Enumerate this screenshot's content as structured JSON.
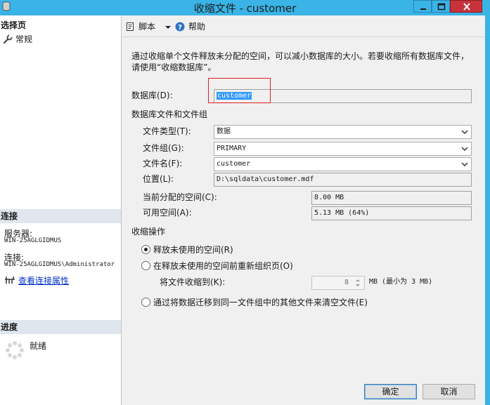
{
  "window": {
    "title": "收缩文件 - customer"
  },
  "left": {
    "select_page_header": "选择页",
    "pages": [
      {
        "label": "常规"
      }
    ],
    "connection_header": "连接",
    "server_label": "服务器:",
    "server_value": "WIN-25AGLGIDMUS",
    "connection_label": "连接:",
    "connection_value": "WIN-25AGLGIDMUS\\Administrator",
    "view_connection_props": "查看连接属性",
    "progress_header": "进度",
    "progress_status": "就绪"
  },
  "toolbar": {
    "script_label": "脚本",
    "help_label": "帮助"
  },
  "description": "通过收缩单个文件释放未分配的空间，可以减小数据库的大小。若要收缩所有数据库文件，请使用“收缩数据库”。",
  "form": {
    "database_label": "数据库(D):",
    "database_value": "customer",
    "files_group_header": "数据库文件和文件组",
    "file_type_label": "文件类型(T):",
    "file_type_value": "数据",
    "filegroup_label": "文件组(G):",
    "filegroup_value": "PRIMARY",
    "filename_label": "文件名(F):",
    "filename_value": "customer",
    "location_label": "位置(L):",
    "location_value": "D:\\sqldata\\customer.mdf",
    "allocated_label": "当前分配的空间(C):",
    "allocated_value": "8.00 MB",
    "available_label": "可用空间(A):",
    "available_value": "5.13 MB (64%)"
  },
  "shrink": {
    "header": "收缩操作",
    "option_release": "释放未使用的空间(R)",
    "option_reorganize": "在释放未使用的空间前重新组织页(O)",
    "shrink_to_label": "将文件收缩到(K):",
    "shrink_to_value": "8",
    "shrink_to_suffix": "MB (最小为 3 MB)",
    "option_empty": "通过将数据迁移到同一文件组中的其他文件来清空文件(E)",
    "selected": "release"
  },
  "buttons": {
    "ok": "确定",
    "cancel": "取消"
  },
  "colors": {
    "titlebar": "#3ab3e6",
    "close": "#c7333a",
    "selection": "#3399ff",
    "highlight_box": "#e0201b"
  }
}
